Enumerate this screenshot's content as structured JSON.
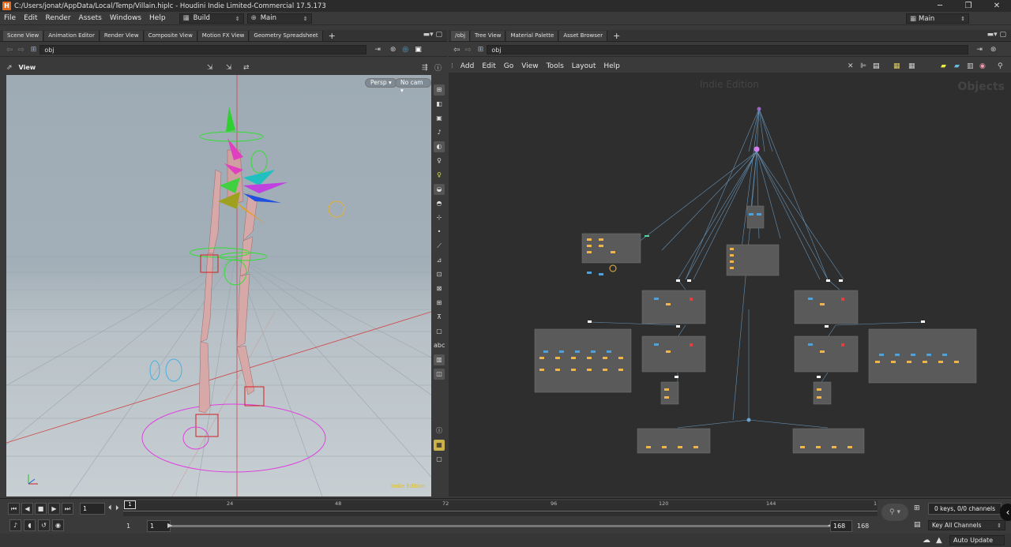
{
  "window": {
    "title": "C:/Users/jonat/AppData/Local/Temp/Villain.hiplc - Houdini Indie Limited-Commercial 17.5.173",
    "buttons": [
      "─",
      "❐",
      "✕"
    ]
  },
  "menu": {
    "items": [
      "File",
      "Edit",
      "Render",
      "Assets",
      "Windows",
      "Help"
    ],
    "shelf_set": "Build",
    "desktop": "Main",
    "right_desktop": "Main"
  },
  "left_tabs": [
    "Scene View",
    "Animation Editor",
    "Render View",
    "Composite View",
    "Motion FX View",
    "Geometry Spreadsheet"
  ],
  "right_tabs": [
    "/obj",
    "Tree View",
    "Material Palette",
    "Asset Browser"
  ],
  "left_path": "obj",
  "right_path": "obj",
  "viewport": {
    "label": "View",
    "persp": "Persp",
    "cam": "No cam",
    "badge": "Indie Edition"
  },
  "network": {
    "menu": [
      "Add",
      "Edit",
      "Go",
      "View",
      "Tools",
      "Layout",
      "Help"
    ],
    "watermark": "Indie Edition",
    "context": "Objects"
  },
  "timeline": {
    "frame": "1",
    "start": "1",
    "start2": "1",
    "end": "168",
    "end2": "168",
    "ticks": [
      "24",
      "48",
      "72",
      "96",
      "120",
      "144"
    ],
    "tick_end": "1",
    "keys": "0 keys, 0/0 channels",
    "key_mode": "Key All Channels",
    "update": "Auto Update"
  },
  "colors": {
    "accent": "#e36b1e",
    "wire": "#4aa3df",
    "node_orange": "#f0b44c",
    "selected_node": "#d87ff0"
  }
}
